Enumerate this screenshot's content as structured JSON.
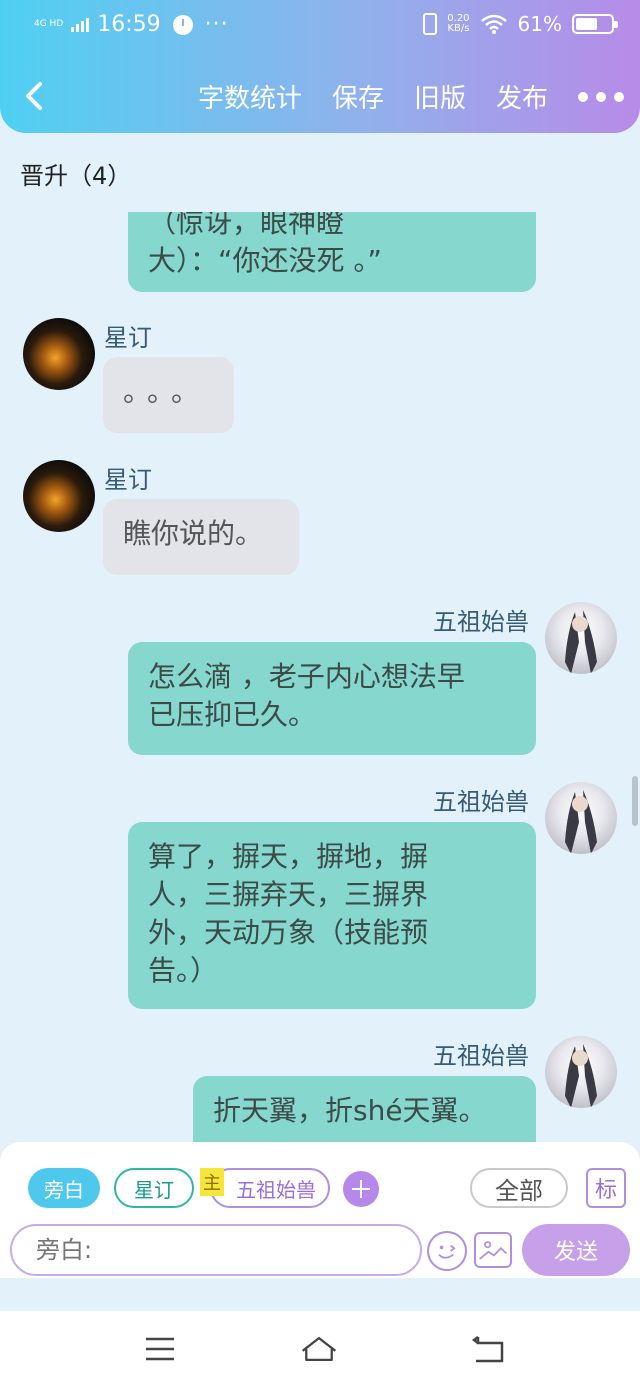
{
  "status_bar": {
    "network": "4G HD",
    "time": "16:59",
    "more_dots": "···",
    "speed_value": "0.20",
    "speed_unit": "KB/s",
    "battery_pct": "61%",
    "battery_level": 0.61
  },
  "toolbar": {
    "word_count": "字数统计",
    "save": "保存",
    "old_version": "旧版",
    "publish": "发布"
  },
  "chapter_title": "晋升（4）",
  "messages": [
    {
      "text_line1": "（惊讶，眼神瞪",
      "text_line2": "大）：“你还没死 。”"
    },
    {
      "sender": "星订",
      "text": "。。。"
    },
    {
      "sender": "星订",
      "text": "瞧你说的。"
    },
    {
      "sender": "五祖始兽",
      "text_line1": "怎么滴 ，老子内心想法早",
      "text_line2": "已压抑已久。"
    },
    {
      "sender": "五祖始兽",
      "text_line1": "算了，摒天，摒地，摒",
      "text_line2": "人，三摒弃天，三摒界",
      "text_line3": "外，天动万象（技能预",
      "text_line4": "告。）"
    },
    {
      "sender": "五祖始兽",
      "text": "折天翼，折shé天翼。"
    }
  ],
  "composer": {
    "roles": {
      "narration": "旁白",
      "xingding": "星订",
      "protag_tag": "主",
      "wuzu": "五祖始兽"
    },
    "all": "全部",
    "mark": "标",
    "input_placeholder": "旁白:",
    "send": "发送"
  }
}
